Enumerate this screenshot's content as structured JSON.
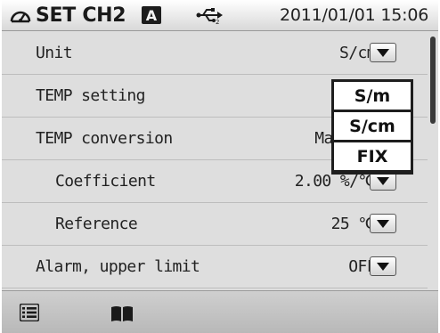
{
  "status_bar": {
    "title": "SET CH2",
    "channel_badge": "A",
    "datetime": "2011/01/01 15:06",
    "icons": [
      "gauge-icon",
      "usb-icon"
    ]
  },
  "settings": [
    {
      "label": "Unit",
      "value": "S/cm",
      "indent": false,
      "has_dropdown": true
    },
    {
      "label": "TEMP setting",
      "value": "",
      "indent": false,
      "has_dropdown": false
    },
    {
      "label": "TEMP conversion",
      "value": "Man",
      "indent": false,
      "has_dropdown": false
    },
    {
      "label": "Coefficient",
      "value": "2.00 %/℃",
      "indent": true,
      "has_dropdown": true
    },
    {
      "label": "Reference",
      "value": "25  ℃",
      "indent": true,
      "has_dropdown": true
    },
    {
      "label": "Alarm, upper limit",
      "value": "OFF",
      "indent": false,
      "has_dropdown": true
    }
  ],
  "unit_popup": {
    "options": [
      "S/m",
      "S/cm",
      "FIX"
    ]
  },
  "bottom_bar": {
    "icons": [
      "list-icon",
      "manual-book-icon"
    ]
  },
  "colors": {
    "background": "#dedede",
    "text": "#222222",
    "popup_border": "#1e1e1e",
    "scroll_thumb": "#3a3a3a"
  }
}
